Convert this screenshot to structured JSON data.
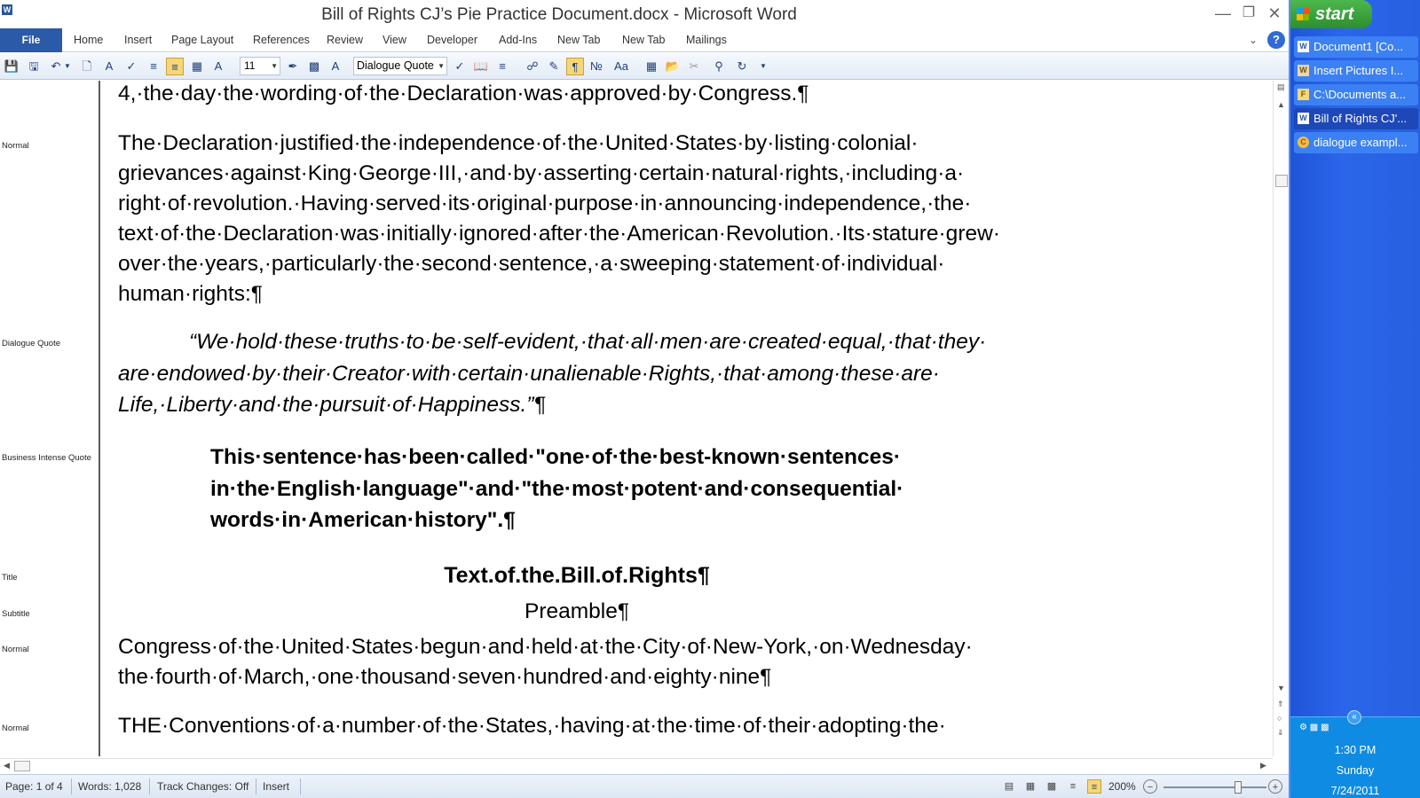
{
  "window": {
    "title": "Bill of Rights CJ’s Pie Practice Document.docx - Microsoft Word",
    "app_icon": "W"
  },
  "ribbon": {
    "file_tab": "File",
    "tabs": [
      "Home",
      "Insert",
      "Page Layout",
      "References",
      "Review",
      "View",
      "Developer",
      "Add-Ins",
      "New Tab",
      "New Tab",
      "Mailings"
    ],
    "help": "?"
  },
  "toolbar": {
    "font_size": "11",
    "style": "Dialogue Quote"
  },
  "style_area": {
    "labels": [
      "Normal",
      "Dialogue Quote",
      "Business Intense Quote",
      "Title",
      "Subtitle",
      "Normal",
      "Normal"
    ]
  },
  "document": {
    "paragraphs": [
      "4,·the·day·the·wording·of·the·Declaration·was·approved·by·Congress.¶",
      "The·Declaration·justified·the·independence·of·the·United·States·by·listing·colonial· grievances·against·King·George·III,·and·by·asserting·certain·natural·rights,·including·a· right·of·revolution.·Having·served·its·original·purpose·in·announcing·independence,·the· text·of·the·Declaration·was·initially·ignored·after·the·American·Revolution.·Its·stature·grew· over·the·years,·particularly·the·second·sentence,·a·sweeping·statement·of·individual· human·rights:¶",
      "“We·hold·these·truths·to·be·self-evident,·that·all·men·are·created·equal,·that·they· are·endowed·by·their·Creator·with·certain·unalienable·Rights,·that·among·these·are· Life,·Liberty·and·the·pursuit·of·Happiness.”¶",
      "This·sentence·has·been·called·\"one·of·the·best-known·sentences· in·the·English·language\"·and·\"the·most·potent·and·consequential· words·in·American·history\".¶",
      "Text.of.the.Bill.of.Rights¶",
      "Preamble¶",
      "Congress·of·the·United·States·begun·and·held·at·the·City·of·New-York,·on·Wednesday· the·fourth·of·March,·one·thousand·seven·hundred·and·eighty·nine¶",
      "THE·Conventions·of·a·number·of·the·States,·having·at·the·time·of·their·adopting·the·"
    ]
  },
  "statusbar": {
    "page": "Page: 1 of 4",
    "words": "Words: 1,028",
    "track_changes": "Track Changes: Off",
    "mode": "Insert",
    "zoom": "200%",
    "zoom_level": 0.72
  },
  "taskbar": {
    "start": "start",
    "items": [
      {
        "label": "Document1 [Co...",
        "icon": "W"
      },
      {
        "label": "Insert Pictures I...",
        "icon": "W"
      },
      {
        "label": "C:\\Documents a...",
        "icon": "F"
      },
      {
        "label": "Bill of Rights CJ'...",
        "icon": "W"
      },
      {
        "label": "dialogue exampl...",
        "icon": "C"
      }
    ],
    "clock": {
      "time": "1:30 PM",
      "day": "Sunday",
      "date": "7/24/2011"
    }
  },
  "colors": {
    "file_tab": "#2a5aa8",
    "taskbar": "#2b66ea",
    "start_button": "#3fa83f"
  }
}
